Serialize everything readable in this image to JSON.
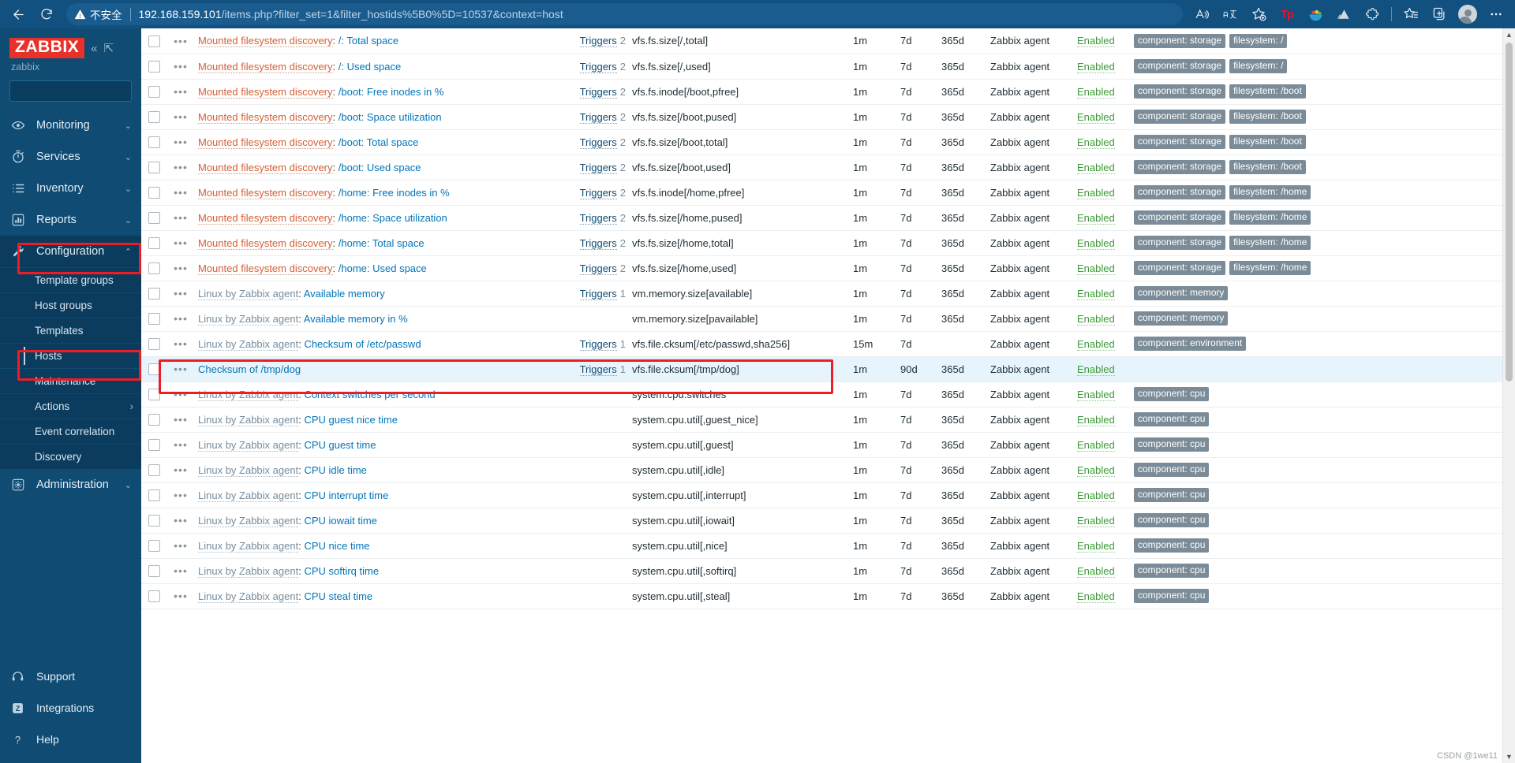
{
  "browser": {
    "back_icon": "back-arrow-icon",
    "reload_icon": "reload-icon",
    "security_label": "不安全",
    "url_host": "192.168.159.101",
    "url_path": "/items.php?filter_set=1&filter_hostids%5B0%5D=10537&context=host",
    "toolbar": {
      "read_aloud": "A",
      "translate": "aあ",
      "favorite_add": "favorites-add-icon",
      "ext_tp": "Tp",
      "ext_bowl": "bowl-icon",
      "ext_mountain": "mountain-icon",
      "ext_puzzle": "puzzle-icon",
      "collections": "collections-icon",
      "split_screen": "split-screen-icon",
      "profile": "profile-avatar",
      "settings": "settings-more-icon"
    }
  },
  "sidebar": {
    "logo_text": "ZABBIX",
    "collapse_icon": "«",
    "expand_icon": "⇱",
    "server_name": "zabbix",
    "search_placeholder": "",
    "search_value": "",
    "nav": [
      {
        "label": "Monitoring",
        "icon": "eye-icon",
        "chevron": "⌄"
      },
      {
        "label": "Services",
        "icon": "stopwatch-icon",
        "chevron": "⌄"
      },
      {
        "label": "Inventory",
        "icon": "list-icon",
        "chevron": "⌄"
      },
      {
        "label": "Reports",
        "icon": "chart-bar-icon",
        "chevron": "⌄"
      },
      {
        "label": "Configuration",
        "icon": "wrench-icon",
        "chevron": "⌃"
      },
      {
        "label": "Administration",
        "icon": "gear-icon",
        "chevron": "⌄"
      }
    ],
    "configuration_submenu": [
      {
        "label": "Template groups"
      },
      {
        "label": "Host groups"
      },
      {
        "label": "Templates"
      },
      {
        "label": "Hosts"
      },
      {
        "label": "Maintenance"
      },
      {
        "label": "Actions",
        "chevron": "›"
      },
      {
        "label": "Event correlation"
      },
      {
        "label": "Discovery"
      }
    ],
    "bottom": [
      {
        "label": "Support",
        "icon": "headset-icon"
      },
      {
        "label": "Integrations",
        "icon": "zabbix-z-icon"
      },
      {
        "label": "Help",
        "icon": "question-icon"
      }
    ],
    "annotations": {
      "configuration_box": "red-highlight-configuration",
      "hosts_box": "red-highlight-hosts"
    }
  },
  "main": {
    "annotation_row_index": 15,
    "highlight_row_index": 13,
    "scrollbar": {
      "up_arrow": "▲",
      "down_arrow": "▼"
    },
    "watermark": "CSDN @1we11",
    "rows": [
      {
        "prefix": "Mounted filesystem discovery",
        "prefix_type": "discovery",
        "name": "/: Total space",
        "triggers": "Triggers",
        "trigger_count": "2",
        "key": "vfs.fs.size[/,total]",
        "interval": "1m",
        "history": "7d",
        "trends": "365d",
        "type": "Zabbix agent",
        "status": "Enabled",
        "tags": [
          "component: storage",
          "filesystem: /"
        ]
      },
      {
        "prefix": "Mounted filesystem discovery",
        "prefix_type": "discovery",
        "name": "/: Used space",
        "triggers": "Triggers",
        "trigger_count": "2",
        "key": "vfs.fs.size[/,used]",
        "interval": "1m",
        "history": "7d",
        "trends": "365d",
        "type": "Zabbix agent",
        "status": "Enabled",
        "tags": [
          "component: storage",
          "filesystem: /"
        ]
      },
      {
        "prefix": "Mounted filesystem discovery",
        "prefix_type": "discovery",
        "name": "/boot: Free inodes in %",
        "triggers": "Triggers",
        "trigger_count": "2",
        "key": "vfs.fs.inode[/boot,pfree]",
        "interval": "1m",
        "history": "7d",
        "trends": "365d",
        "type": "Zabbix agent",
        "status": "Enabled",
        "tags": [
          "component: storage",
          "filesystem: /boot"
        ]
      },
      {
        "prefix": "Mounted filesystem discovery",
        "prefix_type": "discovery",
        "name": "/boot: Space utilization",
        "triggers": "Triggers",
        "trigger_count": "2",
        "key": "vfs.fs.size[/boot,pused]",
        "interval": "1m",
        "history": "7d",
        "trends": "365d",
        "type": "Zabbix agent",
        "status": "Enabled",
        "tags": [
          "component: storage",
          "filesystem: /boot"
        ]
      },
      {
        "prefix": "Mounted filesystem discovery",
        "prefix_type": "discovery",
        "name": "/boot: Total space",
        "triggers": "Triggers",
        "trigger_count": "2",
        "key": "vfs.fs.size[/boot,total]",
        "interval": "1m",
        "history": "7d",
        "trends": "365d",
        "type": "Zabbix agent",
        "status": "Enabled",
        "tags": [
          "component: storage",
          "filesystem: /boot"
        ]
      },
      {
        "prefix": "Mounted filesystem discovery",
        "prefix_type": "discovery",
        "name": "/boot: Used space",
        "triggers": "Triggers",
        "trigger_count": "2",
        "key": "vfs.fs.size[/boot,used]",
        "interval": "1m",
        "history": "7d",
        "trends": "365d",
        "type": "Zabbix agent",
        "status": "Enabled",
        "tags": [
          "component: storage",
          "filesystem: /boot"
        ]
      },
      {
        "prefix": "Mounted filesystem discovery",
        "prefix_type": "discovery",
        "name": "/home: Free inodes in %",
        "triggers": "Triggers",
        "trigger_count": "2",
        "key": "vfs.fs.inode[/home,pfree]",
        "interval": "1m",
        "history": "7d",
        "trends": "365d",
        "type": "Zabbix agent",
        "status": "Enabled",
        "tags": [
          "component: storage",
          "filesystem: /home"
        ]
      },
      {
        "prefix": "Mounted filesystem discovery",
        "prefix_type": "discovery",
        "name": "/home: Space utilization",
        "triggers": "Triggers",
        "trigger_count": "2",
        "key": "vfs.fs.size[/home,pused]",
        "interval": "1m",
        "history": "7d",
        "trends": "365d",
        "type": "Zabbix agent",
        "status": "Enabled",
        "tags": [
          "component: storage",
          "filesystem: /home"
        ]
      },
      {
        "prefix": "Mounted filesystem discovery",
        "prefix_type": "discovery",
        "name": "/home: Total space",
        "triggers": "Triggers",
        "trigger_count": "2",
        "key": "vfs.fs.size[/home,total]",
        "interval": "1m",
        "history": "7d",
        "trends": "365d",
        "type": "Zabbix agent",
        "status": "Enabled",
        "tags": [
          "component: storage",
          "filesystem: /home"
        ]
      },
      {
        "prefix": "Mounted filesystem discovery",
        "prefix_type": "discovery",
        "name": "/home: Used space",
        "triggers": "Triggers",
        "trigger_count": "2",
        "key": "vfs.fs.size[/home,used]",
        "interval": "1m",
        "history": "7d",
        "trends": "365d",
        "type": "Zabbix agent",
        "status": "Enabled",
        "tags": [
          "component: storage",
          "filesystem: /home"
        ]
      },
      {
        "prefix": "Linux by Zabbix agent",
        "prefix_type": "template",
        "name": "Available memory",
        "triggers": "Triggers",
        "trigger_count": "1",
        "key": "vm.memory.size[available]",
        "interval": "1m",
        "history": "7d",
        "trends": "365d",
        "type": "Zabbix agent",
        "status": "Enabled",
        "tags": [
          "component: memory"
        ]
      },
      {
        "prefix": "Linux by Zabbix agent",
        "prefix_type": "template",
        "name": "Available memory in %",
        "triggers": "",
        "trigger_count": "",
        "key": "vm.memory.size[pavailable]",
        "interval": "1m",
        "history": "7d",
        "trends": "365d",
        "type": "Zabbix agent",
        "status": "Enabled",
        "tags": [
          "component: memory"
        ]
      },
      {
        "prefix": "Linux by Zabbix agent",
        "prefix_type": "template",
        "name": "Checksum of /etc/passwd",
        "triggers": "Triggers",
        "trigger_count": "1",
        "key": "vfs.file.cksum[/etc/passwd,sha256]",
        "interval": "15m",
        "history": "7d",
        "trends": "",
        "type": "Zabbix agent",
        "status": "Enabled",
        "tags": [
          "component: environment"
        ]
      },
      {
        "prefix": "",
        "prefix_type": "none",
        "name": "Checksum of /tmp/dog",
        "triggers": "Triggers",
        "trigger_count": "1",
        "key": "vfs.file.cksum[/tmp/dog]",
        "interval": "1m",
        "history": "90d",
        "trends": "365d",
        "type": "Zabbix agent",
        "status": "Enabled",
        "tags": []
      },
      {
        "prefix": "Linux by Zabbix agent",
        "prefix_type": "template",
        "name": "Context switches per second",
        "triggers": "",
        "trigger_count": "",
        "key": "system.cpu.switches",
        "interval": "1m",
        "history": "7d",
        "trends": "365d",
        "type": "Zabbix agent",
        "status": "Enabled",
        "tags": [
          "component: cpu"
        ]
      },
      {
        "prefix": "Linux by Zabbix agent",
        "prefix_type": "template",
        "name": "CPU guest nice time",
        "triggers": "",
        "trigger_count": "",
        "key": "system.cpu.util[,guest_nice]",
        "interval": "1m",
        "history": "7d",
        "trends": "365d",
        "type": "Zabbix agent",
        "status": "Enabled",
        "tags": [
          "component: cpu"
        ]
      },
      {
        "prefix": "Linux by Zabbix agent",
        "prefix_type": "template",
        "name": "CPU guest time",
        "triggers": "",
        "trigger_count": "",
        "key": "system.cpu.util[,guest]",
        "interval": "1m",
        "history": "7d",
        "trends": "365d",
        "type": "Zabbix agent",
        "status": "Enabled",
        "tags": [
          "component: cpu"
        ]
      },
      {
        "prefix": "Linux by Zabbix agent",
        "prefix_type": "template",
        "name": "CPU idle time",
        "triggers": "",
        "trigger_count": "",
        "key": "system.cpu.util[,idle]",
        "interval": "1m",
        "history": "7d",
        "trends": "365d",
        "type": "Zabbix agent",
        "status": "Enabled",
        "tags": [
          "component: cpu"
        ]
      },
      {
        "prefix": "Linux by Zabbix agent",
        "prefix_type": "template",
        "name": "CPU interrupt time",
        "triggers": "",
        "trigger_count": "",
        "key": "system.cpu.util[,interrupt]",
        "interval": "1m",
        "history": "7d",
        "trends": "365d",
        "type": "Zabbix agent",
        "status": "Enabled",
        "tags": [
          "component: cpu"
        ]
      },
      {
        "prefix": "Linux by Zabbix agent",
        "prefix_type": "template",
        "name": "CPU iowait time",
        "triggers": "",
        "trigger_count": "",
        "key": "system.cpu.util[,iowait]",
        "interval": "1m",
        "history": "7d",
        "trends": "365d",
        "type": "Zabbix agent",
        "status": "Enabled",
        "tags": [
          "component: cpu"
        ]
      },
      {
        "prefix": "Linux by Zabbix agent",
        "prefix_type": "template",
        "name": "CPU nice time",
        "triggers": "",
        "trigger_count": "",
        "key": "system.cpu.util[,nice]",
        "interval": "1m",
        "history": "7d",
        "trends": "365d",
        "type": "Zabbix agent",
        "status": "Enabled",
        "tags": [
          "component: cpu"
        ]
      },
      {
        "prefix": "Linux by Zabbix agent",
        "prefix_type": "template",
        "name": "CPU softirq time",
        "triggers": "",
        "trigger_count": "",
        "key": "system.cpu.util[,softirq]",
        "interval": "1m",
        "history": "7d",
        "trends": "365d",
        "type": "Zabbix agent",
        "status": "Enabled",
        "tags": [
          "component: cpu"
        ]
      },
      {
        "prefix": "Linux by Zabbix agent",
        "prefix_type": "template",
        "name": "CPU steal time",
        "triggers": "",
        "trigger_count": "",
        "key": "system.cpu.util[,steal]",
        "interval": "1m",
        "history": "7d",
        "trends": "365d",
        "type": "Zabbix agent",
        "status": "Enabled",
        "tags": [
          "component: cpu"
        ]
      }
    ]
  }
}
